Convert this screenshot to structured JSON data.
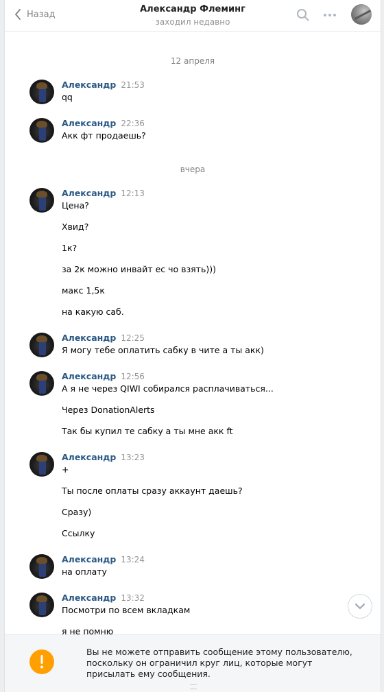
{
  "header": {
    "back_label": "Назад",
    "title": "Александр Флеминг",
    "subtitle": "заходил недавно"
  },
  "dates": [
    "12 апреля",
    "вчера"
  ],
  "messages": [
    {
      "author": "Александр",
      "time": "21:53",
      "lines": [
        "qq"
      ]
    },
    {
      "author": "Александр",
      "time": "22:36",
      "lines": [
        "Акк фт продаешь?"
      ]
    },
    {
      "author": "Александр",
      "time": "12:13",
      "lines": [
        "Цена?",
        "Хвид?",
        "1к?",
        "за 2к можно инвайт ес чо взять)))",
        "макс 1,5к",
        "на какую саб."
      ]
    },
    {
      "author": "Александр",
      "time": "12:25",
      "lines": [
        "Я могу тебе оплатить сабку в чите а ты акк)"
      ]
    },
    {
      "author": "Александр",
      "time": "12:56",
      "lines": [
        "А я не через QIWI собирался расплачиваться...",
        "Через DonationAlerts",
        "Так бы купил те сабку а ты мне акк ft"
      ]
    },
    {
      "author": "Александр",
      "time": "13:23",
      "lines": [
        "+",
        "Ты после оплаты сразу аккаунт даешь?",
        "Сразу)",
        "Ссылку"
      ]
    },
    {
      "author": "Александр",
      "time": "13:24",
      "lines": [
        "на оплату"
      ]
    },
    {
      "author": "Александр",
      "time": "13:32",
      "lines": [
        "Посмотри по всем вкладкам",
        "я не помню"
      ]
    }
  ],
  "notice": {
    "icon": "exclamation-icon",
    "text": "Вы не можете отправить сообщение этому пользователю, поскольку он ограничил круг лиц, которые могут присылать ему сообщения."
  },
  "colors": {
    "author": "#2a5885",
    "notice_icon": "#ffa000",
    "background": "#edeef0"
  }
}
